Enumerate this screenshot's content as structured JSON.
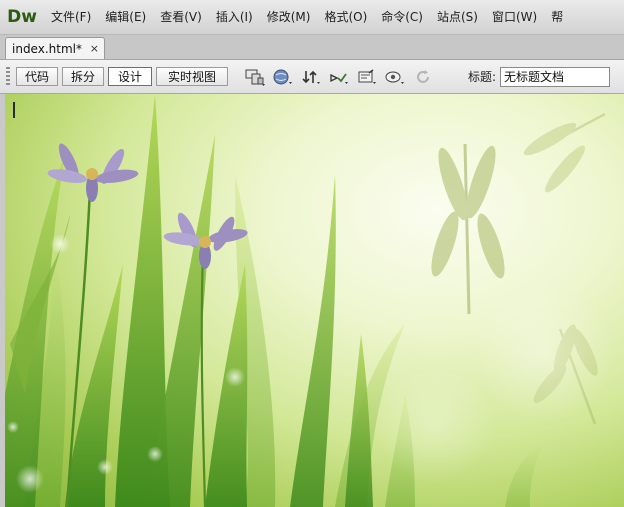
{
  "app": {
    "logo": "Dw"
  },
  "menu": [
    {
      "id": "file",
      "label": "文件(F)"
    },
    {
      "id": "edit",
      "label": "编辑(E)"
    },
    {
      "id": "view",
      "label": "查看(V)"
    },
    {
      "id": "insert",
      "label": "插入(I)"
    },
    {
      "id": "modify",
      "label": "修改(M)"
    },
    {
      "id": "format",
      "label": "格式(O)"
    },
    {
      "id": "commands",
      "label": "命令(C)"
    },
    {
      "id": "site",
      "label": "站点(S)"
    },
    {
      "id": "window",
      "label": "窗口(W)"
    },
    {
      "id": "help",
      "label": "帮"
    }
  ],
  "tabs": [
    {
      "label": "index.html*",
      "close": "×"
    }
  ],
  "toolbar": {
    "views": [
      "代码",
      "拆分",
      "设计",
      "实时视图"
    ],
    "active_view": "设计",
    "icons": [
      "multiscreen-icon",
      "browser-preview-icon",
      "file-management-icon",
      "validate-icon",
      "visual-aids-icon",
      "live-code-icon",
      "refresh-icon"
    ],
    "title_label": "标题:",
    "title_value": "无标题文档"
  },
  "canvas": {
    "background": "grass-flowers-dragonflies",
    "colors": {
      "leaf_dark": "#3f8a1c",
      "leaf_light": "#8cc43a",
      "petal": "#9d90c0",
      "flower_center": "#d7b65a"
    }
  }
}
